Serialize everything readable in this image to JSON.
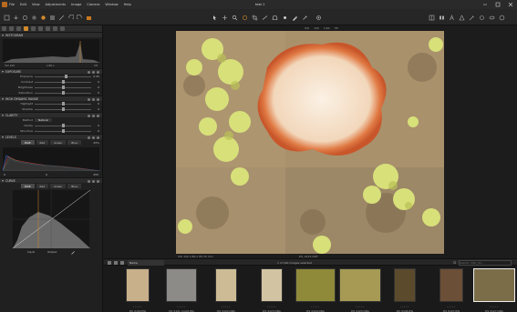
{
  "window": {
    "title": "test 1"
  },
  "menu": [
    "File",
    "Edit",
    "View",
    "Adjustments",
    "Image",
    "Camera",
    "Window",
    "Help"
  ],
  "toolbar": {
    "icons": [
      "cursor-icon",
      "pan-icon",
      "zoom-icon",
      "loupe-icon",
      "crop-icon",
      "straighten-icon",
      "keystone-icon",
      "spot-icon",
      "pen-icon",
      "picker-icon",
      "gear-icon"
    ]
  },
  "left_panel": {
    "histogram_header": "HISTOGRAM",
    "histogram_readout": {
      "left": "ISO 100",
      "mid": "1/60 s",
      "right": "f/8"
    },
    "exposure": {
      "header": "EXPOSURE",
      "rows": [
        {
          "label": "Exposure",
          "value": "0.45",
          "pos": 0.55
        },
        {
          "label": "Contrast",
          "value": "0",
          "pos": 0.5
        },
        {
          "label": "Brightness",
          "value": "0",
          "pos": 0.5
        },
        {
          "label": "Saturation",
          "value": "0",
          "pos": 0.5
        }
      ]
    },
    "hdr": {
      "header": "HIGH DYNAMIC RANGE",
      "rows": [
        {
          "label": "Highlight",
          "value": "0",
          "pos": 0.5
        },
        {
          "label": "Shadow",
          "value": "0",
          "pos": 0.5
        }
      ]
    },
    "clarity": {
      "header": "CLARITY",
      "method_label": "Method",
      "method_value": "Natural",
      "rows": [
        {
          "label": "Clarity",
          "value": "0",
          "pos": 0.5
        },
        {
          "label": "Structure",
          "value": "0",
          "pos": 0.5
        }
      ]
    },
    "levels": {
      "header": "LEVELS",
      "tabs": [
        "RGB",
        "Red",
        "Green",
        "Blue"
      ],
      "active_tab": "RGB",
      "low": "0",
      "mid": "0",
      "high": "255",
      "percent": "25%"
    },
    "curve": {
      "header": "CURVE",
      "tabs": [
        "RGB",
        "Red",
        "Green",
        "Blue"
      ],
      "active_tab": "RGB",
      "input_label": "Input",
      "output_label": "Output"
    }
  },
  "viewer": {
    "top_info": [
      "ISO",
      "100",
      "1/60",
      "f/8"
    ],
    "footer_left": "ISO 100 1/60 s f/8 35 mm",
    "footer_center": "DS_0125.ORF",
    "count_text": "1 of 190 images selected"
  },
  "browser": {
    "sort_label": "Name",
    "search_placeholder": "Search: DSC_01..."
  },
  "filmstrip": [
    {
      "name": "DS_0120.JPG",
      "tone": "#c8b08a"
    },
    {
      "name": "DS_0121_prod2.JPG",
      "tone": "#8c8b88"
    },
    {
      "name": "DS_0122.ORG",
      "tone": "#cdbb95"
    },
    {
      "name": "DS_0123.ORG",
      "tone": "#d2c3a2"
    },
    {
      "name": "DS_0124.ORG",
      "tone": "#8f8a3a"
    },
    {
      "name": "DS_0125.ORG",
      "tone": "#a69a54"
    },
    {
      "name": "DS_0126.JPG",
      "tone": "#5b4a2c"
    },
    {
      "name": "DS_0127.JPG",
      "tone": "#6b4f37"
    },
    {
      "name": "DS_0127.ORG",
      "tone": "#7a6d48"
    }
  ]
}
